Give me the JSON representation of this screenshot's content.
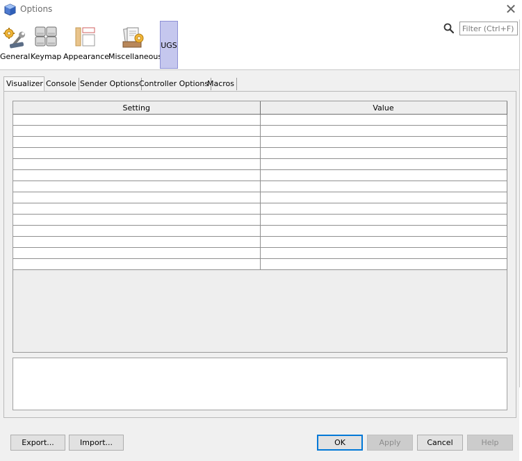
{
  "window": {
    "title": "Options",
    "close_label": "✕"
  },
  "categories": [
    {
      "label": "General",
      "icon": "wrench-gear-icon"
    },
    {
      "label": "Keymap",
      "icon": "keyboard-keys-icon"
    },
    {
      "label": "Appearance",
      "icon": "appearance-layout-icon"
    },
    {
      "label": "Miscellaneous",
      "icon": "documents-gear-icon"
    },
    {
      "label": "UGS",
      "selected": true
    }
  ],
  "search": {
    "placeholder": "Filter (Ctrl+F)",
    "value": ""
  },
  "tabs": [
    {
      "label": "Visualizer",
      "active": true
    },
    {
      "label": "Console"
    },
    {
      "label": "Sender Options"
    },
    {
      "label": "Controller Options"
    },
    {
      "label": "Macros"
    }
  ],
  "table": {
    "columns": [
      "Setting",
      "Value"
    ],
    "empty_rows": 14
  },
  "buttons": {
    "export": "Export...",
    "import": "Import...",
    "ok": "OK",
    "apply": "Apply",
    "cancel": "Cancel",
    "help": "Help"
  },
  "colors": {
    "selected_category_bg": "#c5c7ee",
    "default_button_border": "#0078d7",
    "window_bg": "#f0f0f0"
  }
}
